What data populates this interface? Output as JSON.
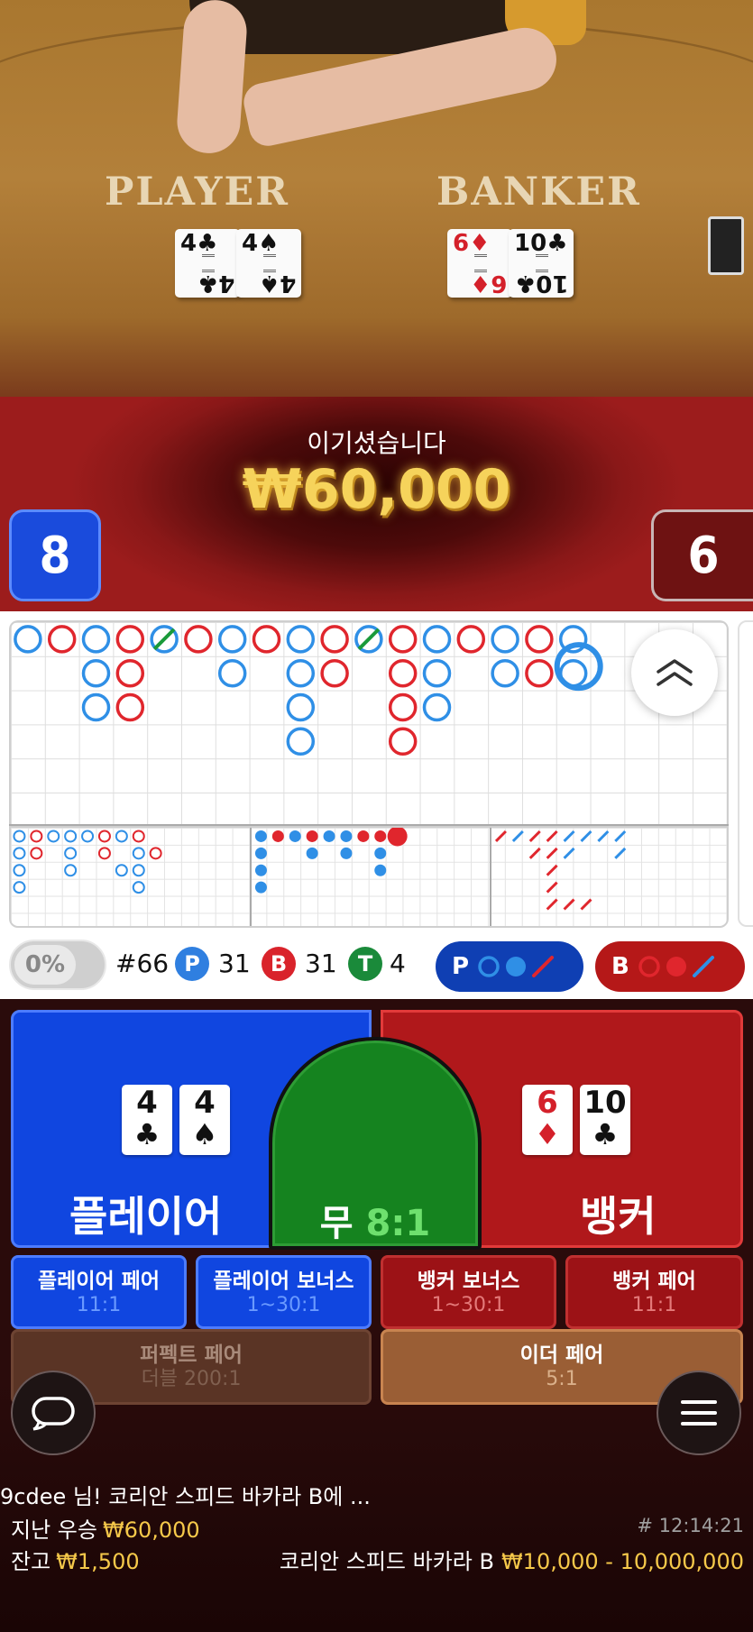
{
  "table": {
    "label_player": "PLAYER",
    "label_banker": "BANKER",
    "player_cards": [
      {
        "value": "4",
        "suit": "♣"
      },
      {
        "value": "4",
        "suit": "♠"
      }
    ],
    "banker_cards": [
      {
        "value": "6",
        "suit": "♦"
      },
      {
        "value": "10",
        "suit": "♣"
      }
    ]
  },
  "result": {
    "message": "이기셨습니다",
    "amount": "₩60,000",
    "player_score": "8",
    "banker_score": "6"
  },
  "stats": {
    "percent": "0%",
    "shoe_round": "#66",
    "player_badge": "P",
    "player_count": "31",
    "banker_badge": "B",
    "banker_count": "31",
    "tie_badge": "T",
    "tie_count": "4",
    "predict_player_label": "P",
    "predict_banker_label": "B"
  },
  "bets": {
    "player_label": "플레이어",
    "banker_label": "뱅커",
    "tie_label": "무",
    "tie_odds": "8:1",
    "player_cards": [
      {
        "value": "4",
        "suit": "♣"
      },
      {
        "value": "4",
        "suit": "♠"
      }
    ],
    "banker_cards": [
      {
        "value": "6",
        "suit": "♦"
      },
      {
        "value": "10",
        "suit": "♣"
      }
    ],
    "side": [
      {
        "name": "플레이어 페어",
        "odds": "11:1"
      },
      {
        "name": "플레이어 보너스",
        "odds": "1~30:1"
      },
      {
        "name": "뱅커 보너스",
        "odds": "1~30:1"
      },
      {
        "name": "뱅커 페어",
        "odds": "11:1"
      }
    ],
    "perfect_pair": {
      "name": "퍼펙트 페어",
      "odds": "더블 200:1"
    },
    "either_pair": {
      "name": "이더 페어",
      "odds": "5:1"
    }
  },
  "footer": {
    "chat_message": "9cdee 님! 코리안 스피드 바카라 B에 ...",
    "last_win_label": "지난 우승",
    "last_win_value": "₩60,000",
    "round_id": "# 12:14:21",
    "balance_label": "잔고",
    "balance_value": "₩1,500",
    "table_name": "코리안 스피드 바카라 B",
    "limits": "₩10,000 - 10,000,000"
  },
  "colors": {
    "player_blue": "#1046e0",
    "banker_red": "#b0181b",
    "tie_green": "#15831f",
    "gold": "#f6c94a",
    "road_blue": "#2f8fe6",
    "road_red": "#e0262d"
  },
  "icons": {
    "chat": "chat-bubble-icon",
    "menu": "hamburger-menu-icon",
    "expand": "double-chevron-up-icon"
  }
}
